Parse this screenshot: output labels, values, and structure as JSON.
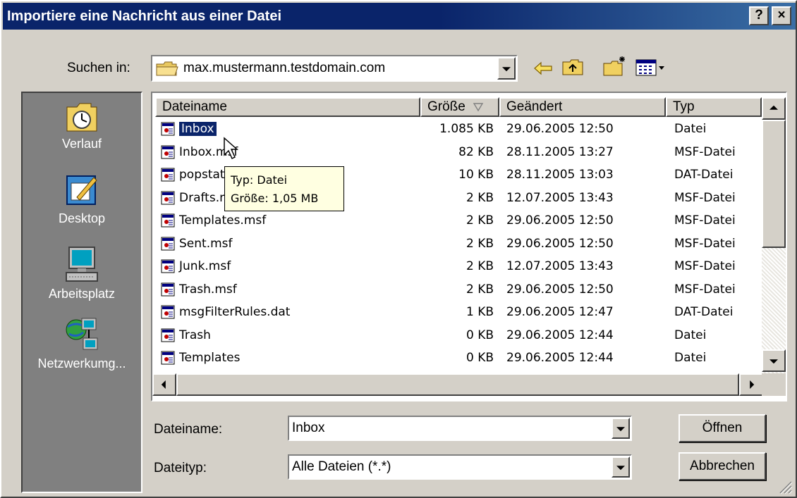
{
  "window": {
    "title": "Importiere eine Nachricht aus einer Datei",
    "help_label": "?",
    "close_label": "×"
  },
  "lookin": {
    "label": "Suchen in:",
    "value": "max.mustermann.testdomain.com"
  },
  "toolbar": {
    "back_icon": "back-arrow-icon",
    "up_icon": "up-folder-icon",
    "newfolder_icon": "new-folder-icon",
    "view_icon": "view-menu-icon"
  },
  "places": [
    {
      "label": "Verlauf",
      "icon": "history-icon"
    },
    {
      "label": "Desktop",
      "icon": "desktop-icon"
    },
    {
      "label": "Arbeitsplatz",
      "icon": "computer-icon"
    },
    {
      "label": "Netzwerkumg...",
      "icon": "network-icon"
    }
  ],
  "columns": {
    "name": "Dateiname",
    "size": "Größe",
    "modified": "Geändert",
    "type": "Typ"
  },
  "files": [
    {
      "name": "Inbox",
      "size": "1.085 KB",
      "modified": "29.06.2005 12:50",
      "type": "Datei"
    },
    {
      "name": "Inbox.msf",
      "size": "82 KB",
      "modified": "28.11.2005 13:27",
      "type": "MSF-Datei"
    },
    {
      "name": "popstate.dat",
      "size": "10 KB",
      "modified": "28.11.2005 13:03",
      "type": "DAT-Datei"
    },
    {
      "name": "Drafts.msf",
      "size": "2 KB",
      "modified": "12.07.2005 13:43",
      "type": "MSF-Datei"
    },
    {
      "name": "Templates.msf",
      "size": "2 KB",
      "modified": "29.06.2005 12:50",
      "type": "MSF-Datei"
    },
    {
      "name": "Sent.msf",
      "size": "2 KB",
      "modified": "29.06.2005 12:50",
      "type": "MSF-Datei"
    },
    {
      "name": "Junk.msf",
      "size": "2 KB",
      "modified": "12.07.2005 13:43",
      "type": "MSF-Datei"
    },
    {
      "name": "Trash.msf",
      "size": "2 KB",
      "modified": "29.06.2005 12:50",
      "type": "MSF-Datei"
    },
    {
      "name": "msgFilterRules.dat",
      "size": "1 KB",
      "modified": "29.06.2005 12:47",
      "type": "DAT-Datei"
    },
    {
      "name": "Trash",
      "size": "0 KB",
      "modified": "29.06.2005 12:44",
      "type": "Datei"
    },
    {
      "name": "Templates",
      "size": "0 KB",
      "modified": "29.06.2005 12:44",
      "type": "Datei"
    }
  ],
  "tooltip": {
    "line1": "Typ: Datei",
    "line2": "Größe: 1,05 MB"
  },
  "filename": {
    "label": "Dateiname:",
    "value": "Inbox"
  },
  "filetype": {
    "label": "Dateityp:",
    "value": "Alle Dateien (*.*)"
  },
  "buttons": {
    "open": "Öffnen",
    "cancel": "Abbrechen"
  },
  "colors": {
    "title_bg": "#0a246a",
    "selection": "#0a246a",
    "face": "#d4d0c8",
    "places_bg": "#808080",
    "tooltip_bg": "#ffffe1"
  }
}
